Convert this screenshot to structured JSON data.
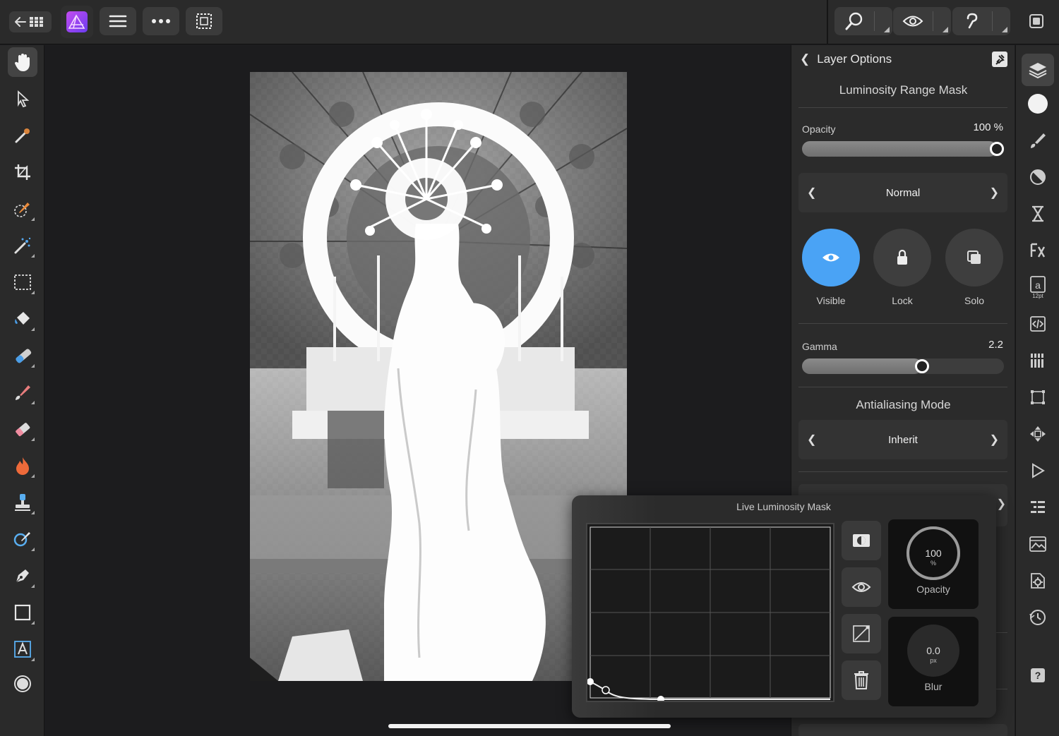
{
  "toolbar": {
    "back_grid_icon": "back-grid-icon",
    "app_icon": "affinity-photo-logo",
    "menu_icon": "hamburger-icon",
    "more_icon": "more-icon",
    "selection_icon": "selection-icon",
    "zoom_icon": "zoom-icon",
    "view_icon": "view-mode-icon",
    "assist_icon": "assistant-icon",
    "window_icon": "window-icon"
  },
  "left_tools": [
    "hand-tool",
    "move-tool",
    "color-picker-tool",
    "crop-tool",
    "selection-brush-tool",
    "flood-select-tool",
    "marquee-tool",
    "flood-fill-tool",
    "gradient-tool",
    "paint-brush-tool",
    "erase-brush-tool",
    "dodge-burn-tool",
    "clone-tool",
    "retouch-tool",
    "pen-tool",
    "rectangle-tool",
    "artistic-text-tool",
    "shape-tool"
  ],
  "layer_options": {
    "back_label": "Layer Options",
    "layer_name": "Luminosity Range Mask",
    "opacity_label": "Opacity",
    "opacity_value": "100 %",
    "opacity_fraction": 1.0,
    "blend_mode": "Normal",
    "visible_label": "Visible",
    "lock_label": "Lock",
    "solo_label": "Solo",
    "gamma_label": "Gamma",
    "gamma_value": "2.2",
    "gamma_fraction": 0.6,
    "antialiasing_title": "Antialiasing Mode",
    "antialiasing_value": "Inherit"
  },
  "live_mask": {
    "title": "Live Luminosity Mask",
    "opacity_value": "100",
    "opacity_unit": "%",
    "opacity_label": "Opacity",
    "blur_value": "0.0",
    "blur_unit": "px",
    "blur_label": "Blur"
  },
  "studio_icons": [
    "layers-icon",
    "color-icon",
    "brush-icon",
    "adjustments-icon",
    "stock-icon",
    "fx-icon",
    "text-styles-icon",
    "code-icon",
    "channels-icon",
    "transform-icon",
    "navigator-icon",
    "macro-icon",
    "library-icon",
    "export-icon",
    "settings-icon",
    "history-icon",
    "help-icon"
  ],
  "colors": {
    "accent": "#4aa3f5",
    "panel_bg": "#2b2b2b",
    "toolbar_bg": "#2a2a2a"
  }
}
